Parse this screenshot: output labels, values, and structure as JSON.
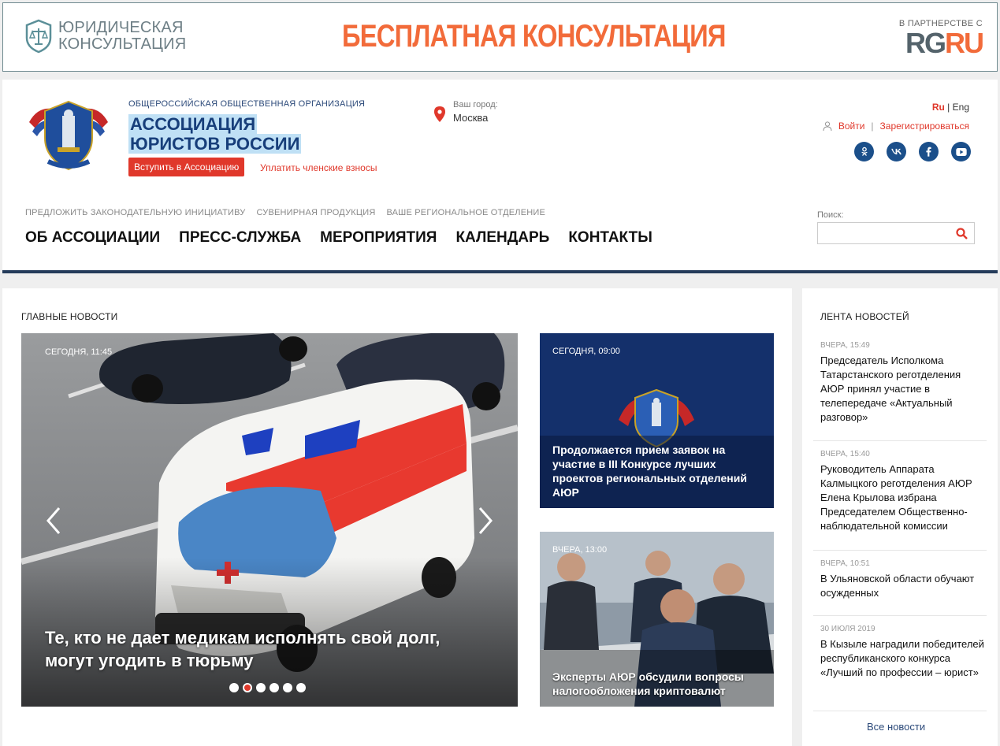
{
  "banner": {
    "logo_line1": "ЮРИДИЧЕСКАЯ",
    "logo_line2": "КОНСУЛЬТАЦИЯ",
    "promo": "БЕСПЛАТНАЯ КОНСУЛЬТАЦИЯ",
    "partner_label": "В ПАРТНЕРСТВЕ С",
    "partner_brand_a": "RG",
    "partner_brand_b": "RU"
  },
  "header": {
    "org_sub": "ОБЩЕРОССИЙСКАЯ ОБЩЕСТВЕННАЯ ОРГАНИЗАЦИЯ",
    "org_title_1": "АССОЦИАЦИЯ",
    "org_title_2": "ЮРИСТОВ РОССИИ",
    "join_button": "Вступить в Ассоциацию",
    "fees_link": "Уплатить членские взносы",
    "city_label": "Ваш город:",
    "city_value": "Москва",
    "lang_ru": "Ru",
    "lang_sep": "|",
    "lang_en": "Eng",
    "login": "Войти",
    "auth_sep": "|",
    "register": "Зарегистрироваться",
    "socials": [
      "ok-icon",
      "vk-icon",
      "facebook-icon",
      "youtube-icon"
    ],
    "subnav": [
      "ПРЕДЛОЖИТЬ ЗАКОНОДАТЕЛЬНУЮ ИНИЦИАТИВУ",
      "СУВЕНИРНАЯ ПРОДУКЦИЯ",
      "ВАШЕ РЕГИОНАЛЬНОЕ ОТДЕЛЕНИЕ"
    ],
    "mainnav": [
      "ОБ АССОЦИАЦИИ",
      "ПРЕСС-СЛУЖБА",
      "МЕРОПРИЯТИЯ",
      "КАЛЕНДАРЬ",
      "КОНТАКТЫ"
    ],
    "search_label": "Поиск:",
    "search_value": ""
  },
  "main": {
    "section_title": "ГЛАВНЫЕ НОВОСТИ",
    "slider": {
      "date": "СЕГОДНЯ, 11:45",
      "headline": "Те, кто не дает медикам исполнять свой долг, могут угодить в тюрьму",
      "dots": 6,
      "active_dot": 1
    },
    "cards": [
      {
        "date": "СЕГОДНЯ, 09:00",
        "title": "Продолжается прием заявок на участие в III Конкурсе лучших проектов региональных отделений АЮР"
      },
      {
        "date": "ВЧЕРА, 13:00",
        "title": "Эксперты АЮР обсудили вопросы налогообложения криптовалют"
      }
    ]
  },
  "feed": {
    "title": "ЛЕНТА НОВОСТЕЙ",
    "items": [
      {
        "time": "ВЧЕРА, 15:49",
        "text": "Председатель Исполкома Татарстанского реготделения АЮР принял участие в телепередаче «Актуальный разговор»"
      },
      {
        "time": "ВЧЕРА, 15:40",
        "text": "Руководитель Аппарата Калмыцкого реготделения АЮР Елена Крылова избрана Председателем Общественно-наблюдательной комиссии"
      },
      {
        "time": "ВЧЕРА, 10:51",
        "text": "В Ульяновской области обучают осужденных"
      },
      {
        "time": "30 ИЮЛЯ 2019",
        "text": "В Кызыле наградили победителей республиканского конкурса «Лучший по профессии – юрист»"
      }
    ],
    "all_news": "Все новости"
  },
  "colors": {
    "accent_red": "#e0382b",
    "brand_navy": "#173e7a",
    "banner_orange": "#f26b3a"
  }
}
